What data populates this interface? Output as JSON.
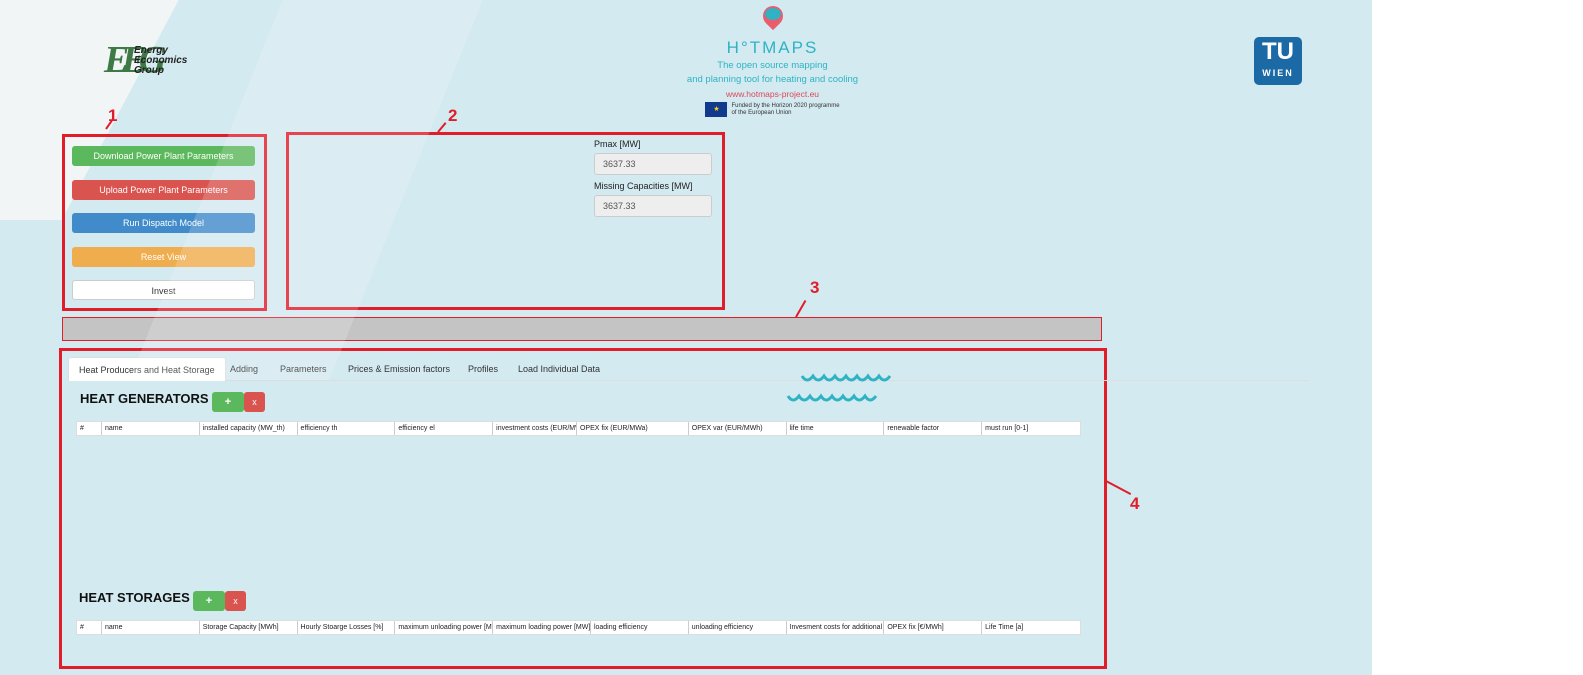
{
  "header": {
    "eeg_mark": "EEG",
    "eeg_lines": [
      "Energy",
      "Economics",
      "Group"
    ],
    "hotmaps_title": "H°TMAPS",
    "hotmaps_tagline_1": "The open source mapping",
    "hotmaps_tagline_2": "and planning tool for heating and cooling",
    "hotmaps_url": "www.hotmaps-project.eu",
    "eu_text_1": "Funded by the Horizon 2020 programme",
    "eu_text_2": "of the European Union",
    "tu_logo_top": "TU",
    "tu_logo_bottom": "WIEN"
  },
  "annotations": [
    "1",
    "2",
    "3",
    "4"
  ],
  "actions": {
    "download": "Download Power Plant Parameters",
    "upload": "Upload Power Plant Parameters",
    "run": "Run Dispatch Model",
    "reset": "Reset View",
    "invest": "Invest"
  },
  "results": {
    "pmax_label": "Pmax [MW]",
    "pmax_value": "3637.33",
    "missing_label": "Missing Capacities [MW]",
    "missing_value": "3637.33"
  },
  "tabs": [
    {
      "label": "Heat Producers and Heat Storage",
      "active": true
    },
    {
      "label": "Adding",
      "active": false
    },
    {
      "label": "Parameters",
      "active": false
    },
    {
      "label": "Prices & Emission factors",
      "active": false
    },
    {
      "label": "Profiles",
      "active": false
    },
    {
      "label": "Load Individual Data",
      "active": false
    }
  ],
  "generators": {
    "title": "HEAT GENERATORS",
    "add_label": "+",
    "remove_label": "x",
    "columns": [
      "#",
      "name",
      "installed capacity (MW_th)",
      "efficiency th",
      "efficiency el",
      "investment costs (EUR/MW_th)",
      "OPEX fix (EUR/MWa)",
      "OPEX var (EUR/MWh)",
      "life time",
      "renewable factor",
      "must run [0-1]"
    ]
  },
  "storages": {
    "title": "HEAT STORAGES",
    "add_label": "+",
    "remove_label": "x",
    "columns": [
      "#",
      "name",
      "Storage Capacity [MWh]",
      "Hourly Stoarge Losses [%]",
      "maximum unloading power [MW]",
      "maximum loading power [MW]",
      "loading efficiency",
      "unloading efficiency",
      "Invesment costs for additional",
      "OPEX fix [€/MWh]",
      "Life Time [a]"
    ]
  },
  "colors": {
    "accent_red": "#e11d2a",
    "hotmaps_teal": "#2fb3c4",
    "tu_blue": "#1b6aa6",
    "background": "#d3eaf0"
  },
  "icons": [
    "hotmaps-pin-icon",
    "eu-flag-icon",
    "waves-icon"
  ]
}
